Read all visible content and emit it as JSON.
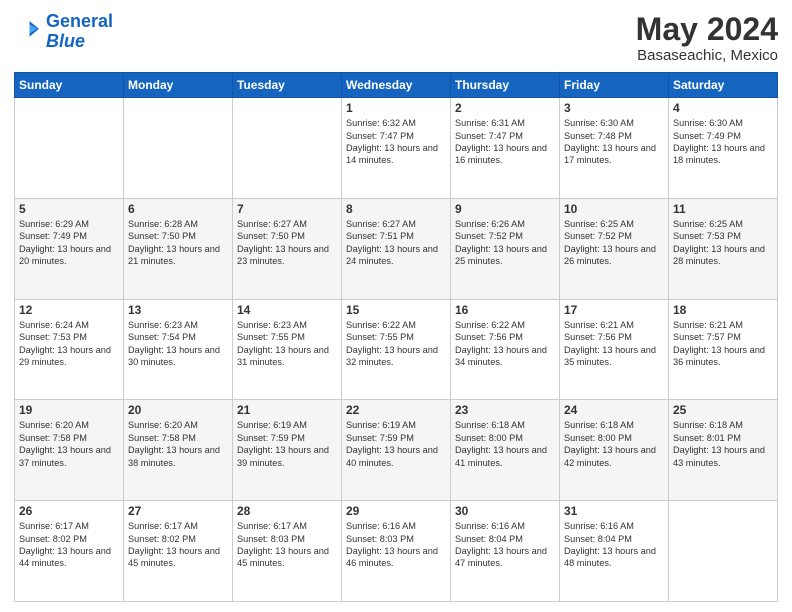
{
  "header": {
    "logo_line1": "General",
    "logo_line2": "Blue",
    "title": "May 2024",
    "subtitle": "Basaseachic, Mexico"
  },
  "calendar": {
    "headers": [
      "Sunday",
      "Monday",
      "Tuesday",
      "Wednesday",
      "Thursday",
      "Friday",
      "Saturday"
    ],
    "rows": [
      {
        "alt": false,
        "cells": [
          {
            "day": "",
            "content": ""
          },
          {
            "day": "",
            "content": ""
          },
          {
            "day": "",
            "content": ""
          },
          {
            "day": "1",
            "content": "Sunrise: 6:32 AM\nSunset: 7:47 PM\nDaylight: 13 hours\nand 14 minutes."
          },
          {
            "day": "2",
            "content": "Sunrise: 6:31 AM\nSunset: 7:47 PM\nDaylight: 13 hours\nand 16 minutes."
          },
          {
            "day": "3",
            "content": "Sunrise: 6:30 AM\nSunset: 7:48 PM\nDaylight: 13 hours\nand 17 minutes."
          },
          {
            "day": "4",
            "content": "Sunrise: 6:30 AM\nSunset: 7:49 PM\nDaylight: 13 hours\nand 18 minutes."
          }
        ]
      },
      {
        "alt": true,
        "cells": [
          {
            "day": "5",
            "content": "Sunrise: 6:29 AM\nSunset: 7:49 PM\nDaylight: 13 hours\nand 20 minutes."
          },
          {
            "day": "6",
            "content": "Sunrise: 6:28 AM\nSunset: 7:50 PM\nDaylight: 13 hours\nand 21 minutes."
          },
          {
            "day": "7",
            "content": "Sunrise: 6:27 AM\nSunset: 7:50 PM\nDaylight: 13 hours\nand 23 minutes."
          },
          {
            "day": "8",
            "content": "Sunrise: 6:27 AM\nSunset: 7:51 PM\nDaylight: 13 hours\nand 24 minutes."
          },
          {
            "day": "9",
            "content": "Sunrise: 6:26 AM\nSunset: 7:52 PM\nDaylight: 13 hours\nand 25 minutes."
          },
          {
            "day": "10",
            "content": "Sunrise: 6:25 AM\nSunset: 7:52 PM\nDaylight: 13 hours\nand 26 minutes."
          },
          {
            "day": "11",
            "content": "Sunrise: 6:25 AM\nSunset: 7:53 PM\nDaylight: 13 hours\nand 28 minutes."
          }
        ]
      },
      {
        "alt": false,
        "cells": [
          {
            "day": "12",
            "content": "Sunrise: 6:24 AM\nSunset: 7:53 PM\nDaylight: 13 hours\nand 29 minutes."
          },
          {
            "day": "13",
            "content": "Sunrise: 6:23 AM\nSunset: 7:54 PM\nDaylight: 13 hours\nand 30 minutes."
          },
          {
            "day": "14",
            "content": "Sunrise: 6:23 AM\nSunset: 7:55 PM\nDaylight: 13 hours\nand 31 minutes."
          },
          {
            "day": "15",
            "content": "Sunrise: 6:22 AM\nSunset: 7:55 PM\nDaylight: 13 hours\nand 32 minutes."
          },
          {
            "day": "16",
            "content": "Sunrise: 6:22 AM\nSunset: 7:56 PM\nDaylight: 13 hours\nand 34 minutes."
          },
          {
            "day": "17",
            "content": "Sunrise: 6:21 AM\nSunset: 7:56 PM\nDaylight: 13 hours\nand 35 minutes."
          },
          {
            "day": "18",
            "content": "Sunrise: 6:21 AM\nSunset: 7:57 PM\nDaylight: 13 hours\nand 36 minutes."
          }
        ]
      },
      {
        "alt": true,
        "cells": [
          {
            "day": "19",
            "content": "Sunrise: 6:20 AM\nSunset: 7:58 PM\nDaylight: 13 hours\nand 37 minutes."
          },
          {
            "day": "20",
            "content": "Sunrise: 6:20 AM\nSunset: 7:58 PM\nDaylight: 13 hours\nand 38 minutes."
          },
          {
            "day": "21",
            "content": "Sunrise: 6:19 AM\nSunset: 7:59 PM\nDaylight: 13 hours\nand 39 minutes."
          },
          {
            "day": "22",
            "content": "Sunrise: 6:19 AM\nSunset: 7:59 PM\nDaylight: 13 hours\nand 40 minutes."
          },
          {
            "day": "23",
            "content": "Sunrise: 6:18 AM\nSunset: 8:00 PM\nDaylight: 13 hours\nand 41 minutes."
          },
          {
            "day": "24",
            "content": "Sunrise: 6:18 AM\nSunset: 8:00 PM\nDaylight: 13 hours\nand 42 minutes."
          },
          {
            "day": "25",
            "content": "Sunrise: 6:18 AM\nSunset: 8:01 PM\nDaylight: 13 hours\nand 43 minutes."
          }
        ]
      },
      {
        "alt": false,
        "cells": [
          {
            "day": "26",
            "content": "Sunrise: 6:17 AM\nSunset: 8:02 PM\nDaylight: 13 hours\nand 44 minutes."
          },
          {
            "day": "27",
            "content": "Sunrise: 6:17 AM\nSunset: 8:02 PM\nDaylight: 13 hours\nand 45 minutes."
          },
          {
            "day": "28",
            "content": "Sunrise: 6:17 AM\nSunset: 8:03 PM\nDaylight: 13 hours\nand 45 minutes."
          },
          {
            "day": "29",
            "content": "Sunrise: 6:16 AM\nSunset: 8:03 PM\nDaylight: 13 hours\nand 46 minutes."
          },
          {
            "day": "30",
            "content": "Sunrise: 6:16 AM\nSunset: 8:04 PM\nDaylight: 13 hours\nand 47 minutes."
          },
          {
            "day": "31",
            "content": "Sunrise: 6:16 AM\nSunset: 8:04 PM\nDaylight: 13 hours\nand 48 minutes."
          },
          {
            "day": "",
            "content": ""
          }
        ]
      }
    ]
  }
}
